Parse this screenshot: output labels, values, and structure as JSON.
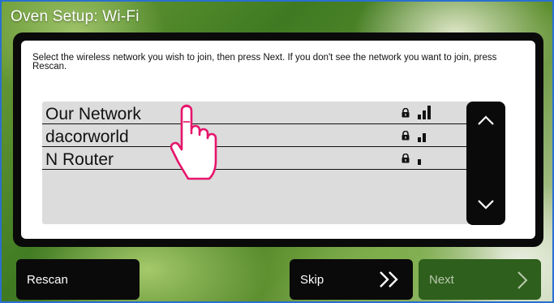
{
  "header": {
    "title": "Oven Setup: Wi-Fi"
  },
  "dialog": {
    "instructions": "Select the wireless network you wish to join, then press Next. If you don't see the network you want to join, press Rescan."
  },
  "networks": [
    {
      "name": "Our Network",
      "secured": true,
      "signal_bars": 3
    },
    {
      "name": "dacorworld",
      "secured": true,
      "signal_bars": 2
    },
    {
      "name": "N Router",
      "secured": true,
      "signal_bars": 1
    }
  ],
  "scroll": {
    "up_icon": "chevron-up-icon",
    "down_icon": "chevron-down-icon"
  },
  "buttons": {
    "rescan_label": "Rescan",
    "skip_label": "Skip",
    "next_label": "Next"
  },
  "colors": {
    "panel": "#0a0a0a",
    "next_button_disabled": "#2e5f1d",
    "pointer_hand": "#e6156b",
    "frame_border": "#2a6fd0"
  }
}
